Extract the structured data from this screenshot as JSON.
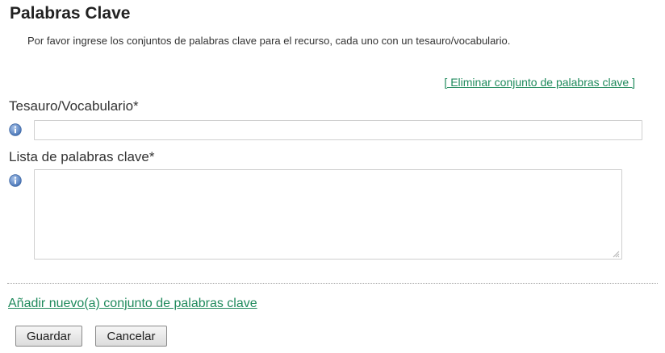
{
  "page": {
    "title": "Palabras Clave",
    "description": "Por favor ingrese los conjuntos de palabras clave para el recurso, cada uno con un tesauro/vocabulario."
  },
  "keyword_set": {
    "remove_link": "[ Eliminar conjunto de palabras clave ]",
    "thesaurus": {
      "label": "Tesauro/Vocabulario*",
      "value": "",
      "icon": "info-icon"
    },
    "keywords": {
      "label": "Lista de palabras clave*",
      "value": "",
      "icon": "info-icon"
    }
  },
  "actions": {
    "add_link": "Añadir nuevo(a) conjunto de palabras clave",
    "save_label": "Guardar",
    "cancel_label": "Cancelar"
  },
  "colors": {
    "link": "#1f8a5c",
    "info_icon": "#5b86c5",
    "border": "#cfcfcf"
  }
}
